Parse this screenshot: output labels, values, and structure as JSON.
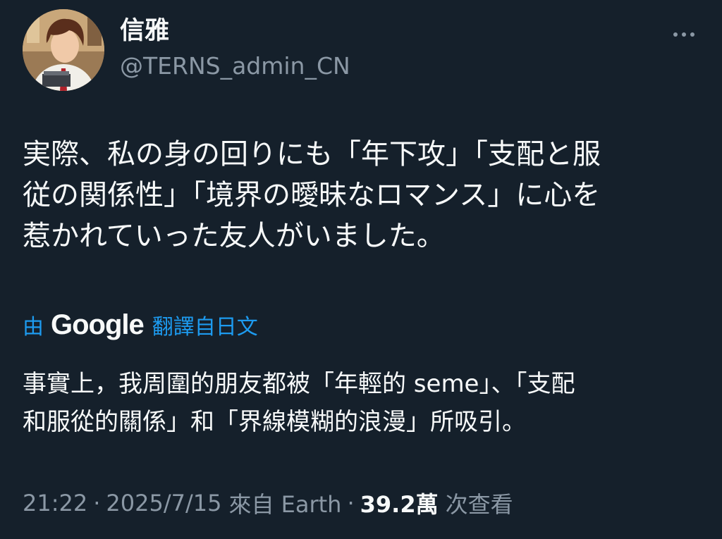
{
  "tweet": {
    "author": {
      "display_name": "信雅",
      "handle": "@TERNS_admin_CN"
    },
    "more_icon": "more-horizontal-icon",
    "original_text": "実際、私の身の回りにも「年下攻」「支配と服\n従の関係性」「境界の曖昧なロマンス」に心を\n惹かれていった友人がいました。",
    "translation": {
      "by_label": "由",
      "provider": "Google",
      "label": "翻譯自日文",
      "text": "事實上，我周圍的朋友都被「年輕的 seme」、「支配\n和服從的關係」和「界線模糊的浪漫」所吸引。"
    },
    "meta": {
      "time": "21:22",
      "separator": "·",
      "date": "2025/7/15",
      "source": "來自 Earth",
      "views_count": "39.2萬",
      "views_label": "次查看"
    }
  },
  "colors": {
    "background": "#15202b",
    "text_primary": "#f7f9f9",
    "text_secondary": "#8b98a5",
    "accent": "#1d9bf0"
  }
}
